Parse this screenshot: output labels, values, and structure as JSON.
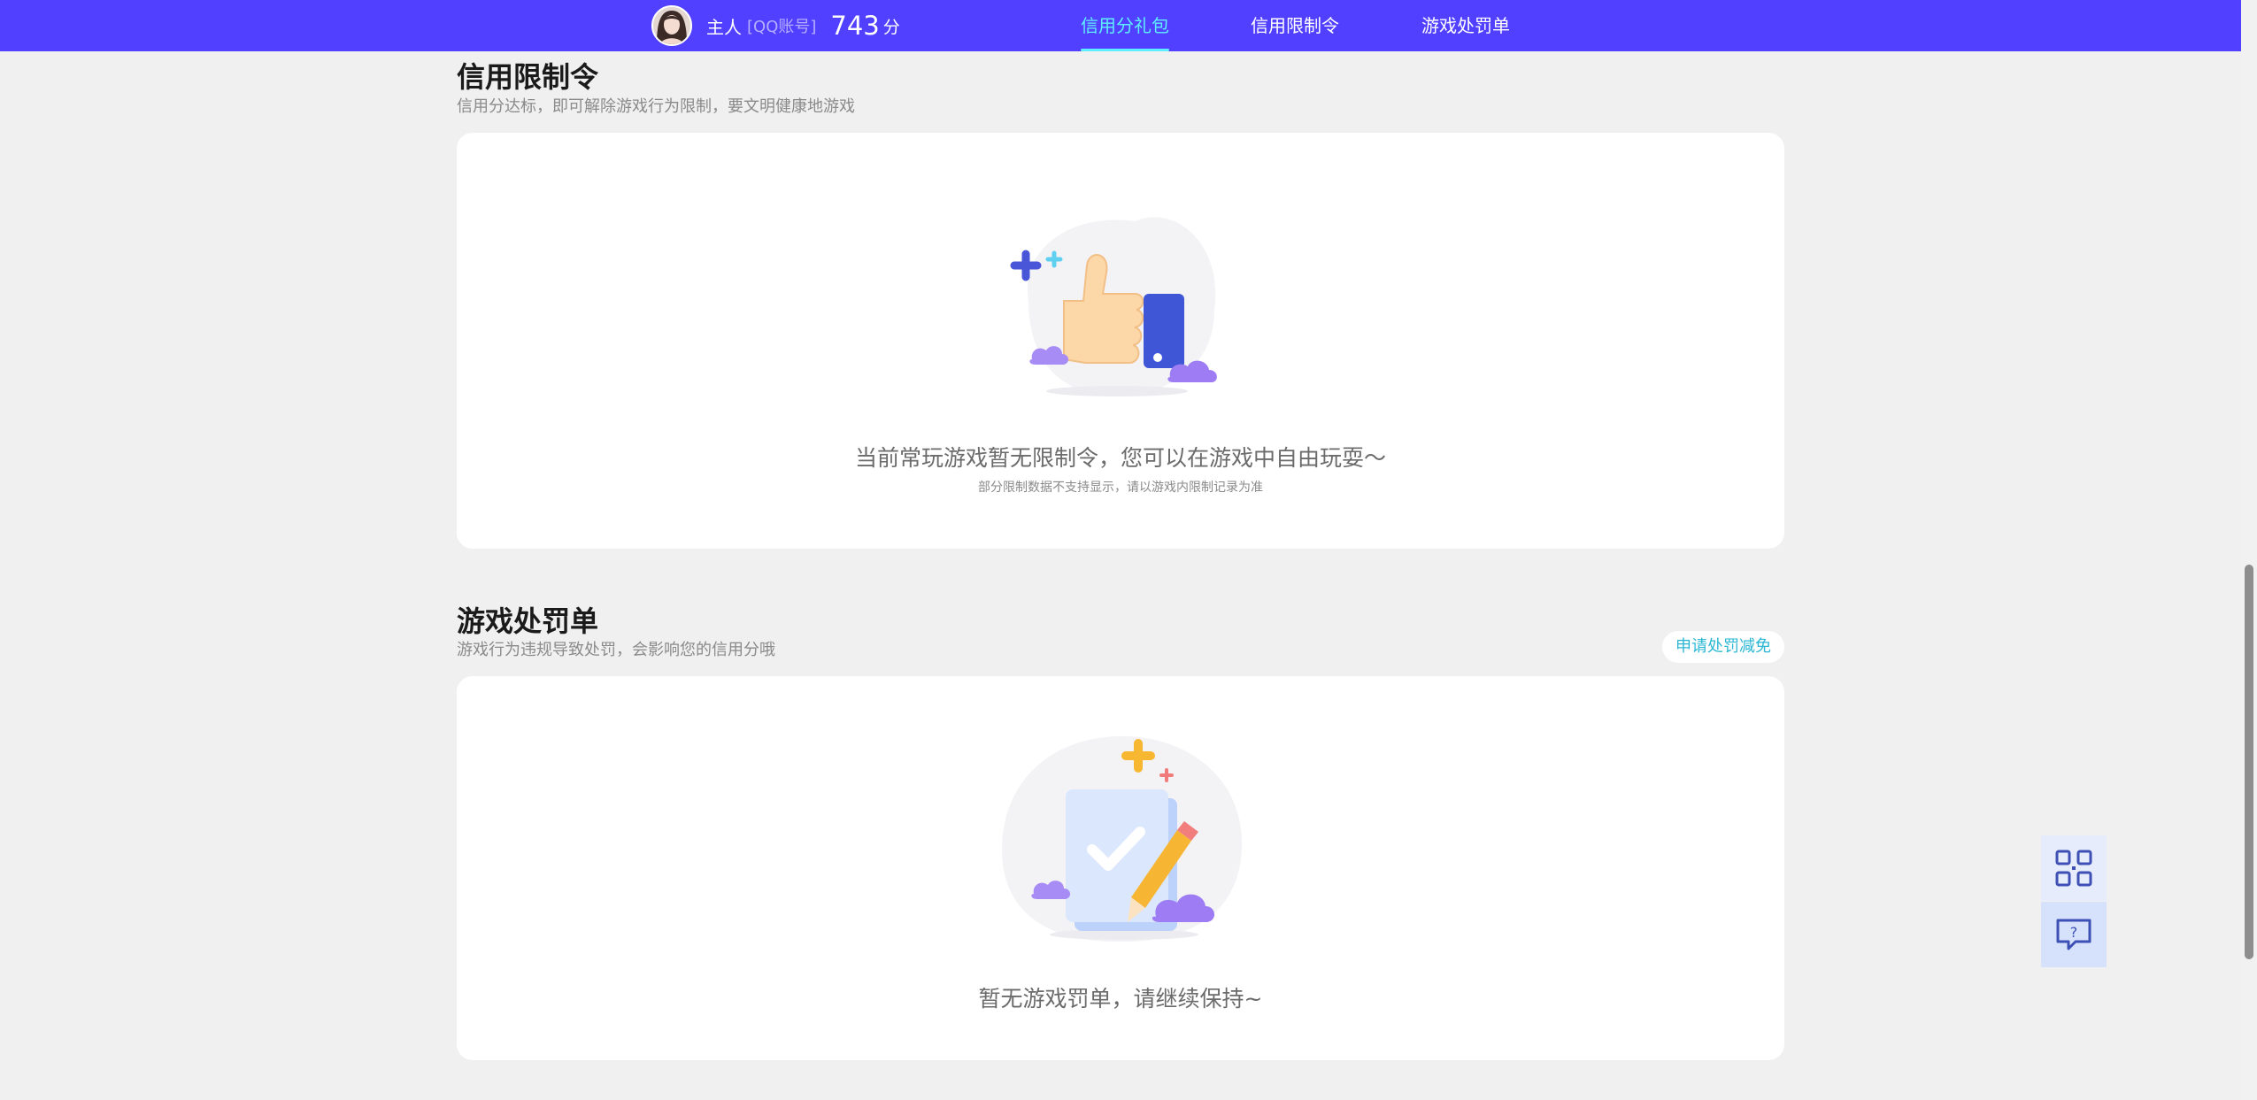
{
  "header": {
    "user_name": "主人",
    "account_label": "[QQ账号]",
    "score": "743",
    "score_unit": "分",
    "tabs": [
      {
        "label": "信用分礼包",
        "active": true
      },
      {
        "label": "信用限制令",
        "active": false
      },
      {
        "label": "游戏处罚单",
        "active": false
      }
    ],
    "bg_color": "#5140ff",
    "active_color": "#5ef0ff"
  },
  "restriction_section": {
    "title": "信用限制令",
    "desc": "信用分达标，即可解除游戏行为限制，要文明健康地游戏",
    "illustration_icon": "thumbs-up-illustration",
    "empty_text": "当前常玩游戏暂无限制令，您可以在游戏中自由玩耍～",
    "note_text": "部分限制数据不支持显示，请以游戏内限制记录为准"
  },
  "penalty_section": {
    "title": "游戏处罚单",
    "desc": "游戏行为违规导致处罚，会影响您的信用分哦",
    "appeal_button": "申请处罚减免",
    "illustration_icon": "clipboard-pencil-illustration",
    "empty_text": "暂无游戏罚单，请继续保持~"
  },
  "side_tools": [
    {
      "icon": "qr-code-icon"
    },
    {
      "icon": "help-chat-icon"
    }
  ]
}
